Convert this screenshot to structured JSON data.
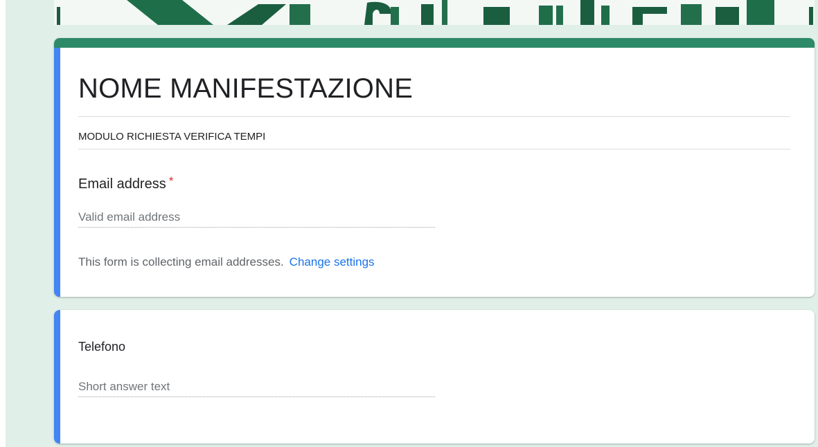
{
  "form": {
    "title": "NOME MANIFESTAZIONE",
    "description": "MODULO RICHIESTA VERIFICA TEMPI"
  },
  "email_question": {
    "label": "Email address",
    "required_mark": "*",
    "placeholder": "Valid email address",
    "note": "This form is collecting email addresses.",
    "change_settings_link": "Change settings"
  },
  "questions": [
    {
      "label": "Telefono",
      "placeholder": "Short answer text"
    }
  ],
  "colors": {
    "theme_green": "#2d8a68",
    "background": "#e0efe8",
    "active_accent": "#4285f4",
    "link": "#1a73e8",
    "required": "#d93025"
  }
}
